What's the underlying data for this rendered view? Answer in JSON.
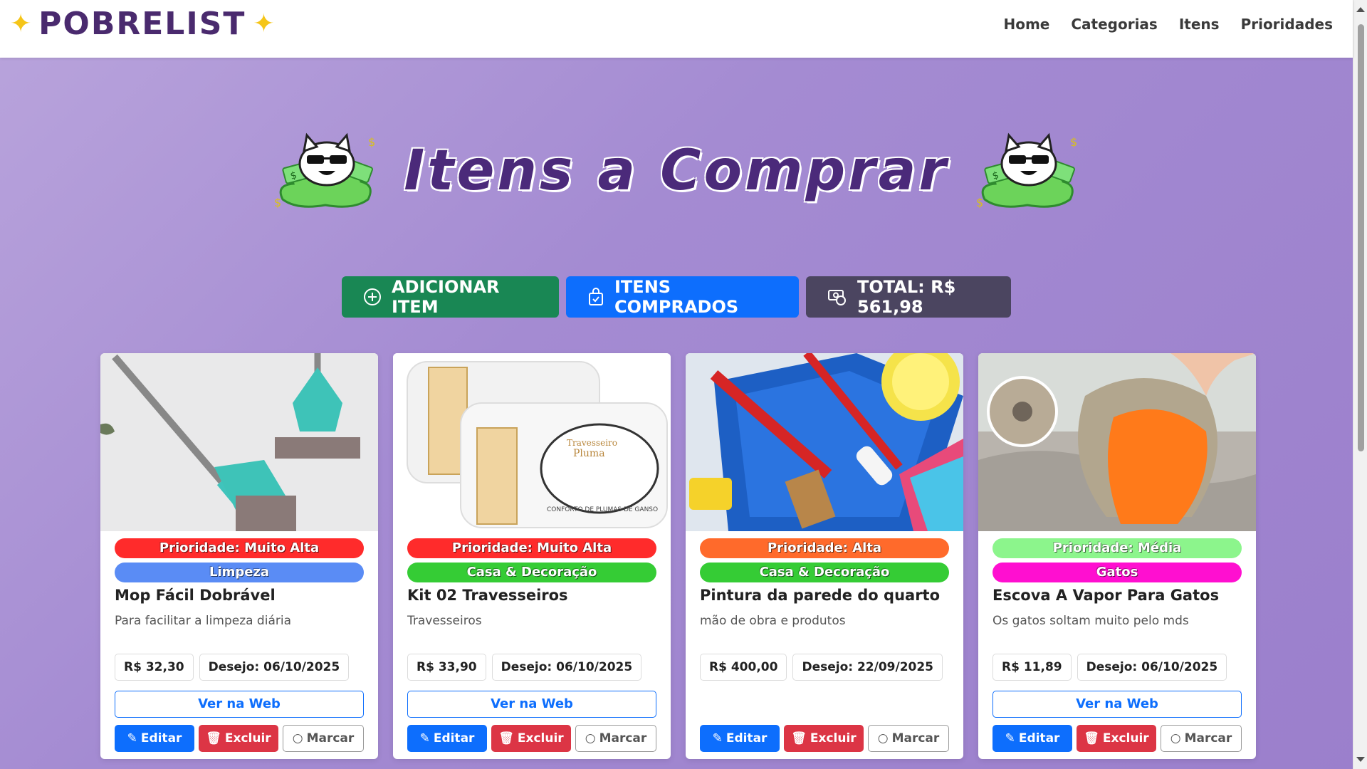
{
  "brand": {
    "name": "POBRELIST"
  },
  "nav": {
    "home": "Home",
    "categorias": "Categorias",
    "itens": "Itens",
    "prioridades": "Prioridades"
  },
  "hero": {
    "title": "Itens a Comprar"
  },
  "actions": {
    "add": "ADICIONAR ITEM",
    "bought": "ITENS COMPRADOS",
    "total": "TOTAL: R$ 561,98"
  },
  "colors": {
    "muito_alta": "#ff2b2b",
    "alta": "#ff6a2b",
    "media": "#8cf58c",
    "limpeza": "#5a8cf5",
    "casa": "#35cc35",
    "gatos": "#ff0fd0"
  },
  "cards": [
    {
      "priority": "Prioridade: Muito Alta",
      "category": "Limpeza",
      "title": "Mop Fácil Dobrável",
      "desc": "Para facilitar a limpeza diária",
      "price": "R$ 32,30",
      "wish": "Desejo: 06/10/2025",
      "web": "Ver na Web",
      "edit": "Editar",
      "delete": "Excluir",
      "mark": "Marcar"
    },
    {
      "priority": "Prioridade: Muito Alta",
      "category": "Casa & Decoração",
      "title": "Kit 02 Travesseiros",
      "desc": "Travesseiros",
      "price": "R$ 33,90",
      "wish": "Desejo: 06/10/2025",
      "web": "Ver na Web",
      "edit": "Editar",
      "delete": "Excluir",
      "mark": "Marcar",
      "img_text1": "Travesseiro Pluma",
      "img_text2": "CONFORTO DE PLUMAS DE GANSO"
    },
    {
      "priority": "Prioridade: Alta",
      "category": "Casa & Decoração",
      "title": "Pintura da parede do quarto",
      "desc": "mão de obra e produtos",
      "price": "R$ 400,00",
      "wish": "Desejo: 22/09/2025",
      "edit": "Editar",
      "delete": "Excluir",
      "mark": "Marcar"
    },
    {
      "priority": "Prioridade: Média",
      "category": "Gatos",
      "title": "Escova A Vapor Para Gatos",
      "desc": "Os gatos soltam muito pelo mds",
      "price": "R$ 11,89",
      "wish": "Desejo: 06/10/2025",
      "web": "Ver na Web",
      "edit": "Editar",
      "delete": "Excluir",
      "mark": "Marcar"
    }
  ]
}
